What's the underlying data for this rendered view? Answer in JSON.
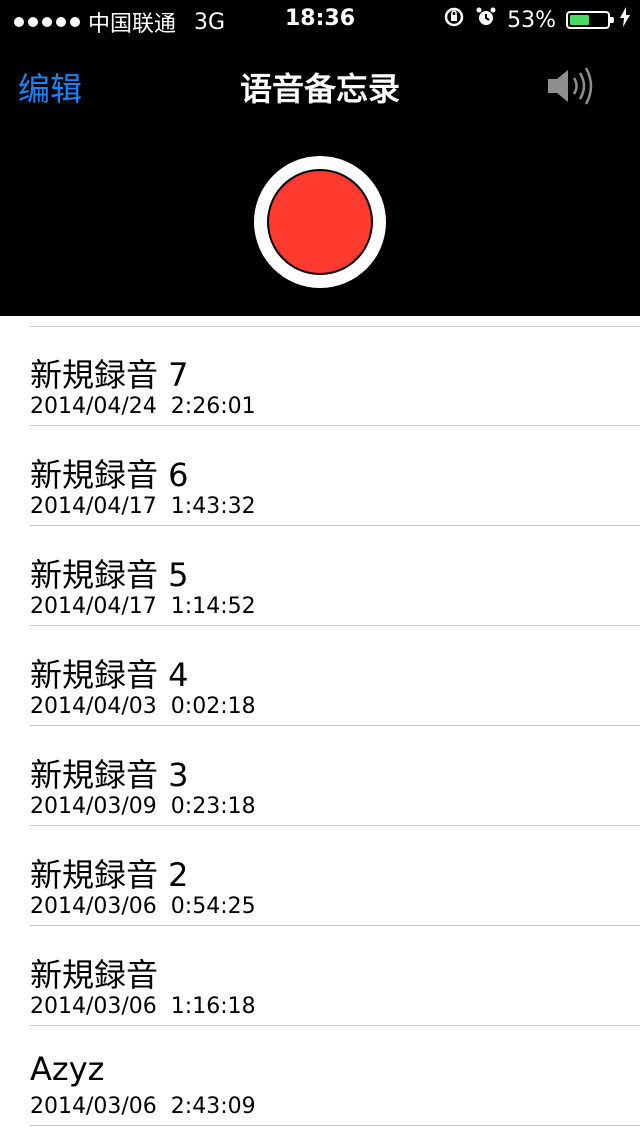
{
  "status_bar": {
    "carrier": "中国联通",
    "network": "3G",
    "time": "18:36",
    "battery": "53%",
    "battery_level": 0.53,
    "icons": [
      "rotation-lock-icon",
      "alarm-icon",
      "charging-icon"
    ]
  },
  "navbar": {
    "edit_label": "编辑",
    "title": "语音备忘录",
    "speaker_icon": "speaker-icon"
  },
  "colors": {
    "accent": "#1a82fb",
    "record": "#ff3b30",
    "battery_fill": "#4cd964",
    "separator": "#c8c7cc"
  },
  "recordings": [
    {
      "name": "新規録音 7",
      "date": "2014/04/24  2:26:01"
    },
    {
      "name": "新規録音 6",
      "date": "2014/04/17  1:43:32"
    },
    {
      "name": "新規録音 5",
      "date": "2014/04/17  1:14:52"
    },
    {
      "name": "新規録音 4",
      "date": "2014/04/03  0:02:18"
    },
    {
      "name": "新規録音 3",
      "date": "2014/03/09  0:23:18"
    },
    {
      "name": "新規録音 2",
      "date": "2014/03/06  0:54:25"
    },
    {
      "name": "新規録音",
      "date": "2014/03/06  1:16:18"
    },
    {
      "name": "Azyz",
      "date": "2014/03/06  2:43:09"
    }
  ]
}
